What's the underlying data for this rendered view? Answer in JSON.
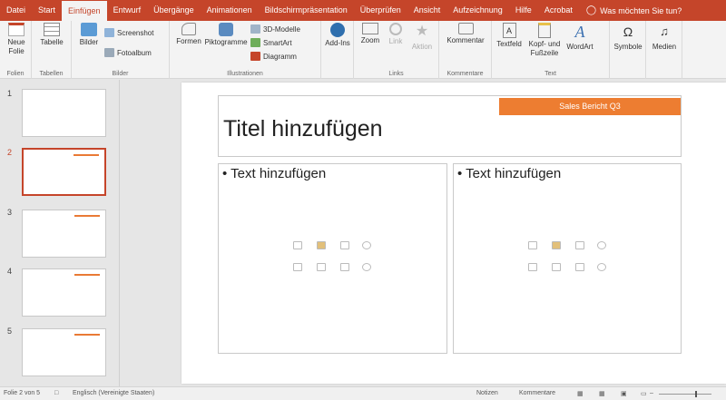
{
  "tabs": [
    "Datei",
    "Start",
    "Einfügen",
    "Entwurf",
    "Übergänge",
    "Animationen",
    "Bildschirmpräsentation",
    "Überprüfen",
    "Ansicht",
    "Aufzeichnung",
    "Hilfe",
    "Acrobat"
  ],
  "active_tab": "Einfügen",
  "tell_me": "Was möchten Sie tun?",
  "ribbon": {
    "neue_folie": "Neue Folie",
    "tabelle": "Tabelle",
    "bilder": "Bilder",
    "screenshot": "Screenshot",
    "fotoalbum": "Fotoalbum",
    "formen": "Formen",
    "piktogramme": "Piktogramme",
    "modelle_3d": "3D-Modelle",
    "smartart": "SmartArt",
    "diagramm": "Diagramm",
    "addins": "Add-Ins",
    "zoom": "Zoom",
    "link": "Link",
    "aktion": "Aktion",
    "kommentar": "Kommentar",
    "textfeld": "Textfeld",
    "kopf_fusszeile": "Kopf- und Fußzeile",
    "wordart": "WordArt",
    "symbole": "Symbole",
    "medien": "Medien",
    "groups": {
      "folien": "Folien",
      "tabellen": "Tabellen",
      "bilder": "Bilder",
      "illustrationen": "Illustrationen",
      "links": "Links",
      "kommentare": "Kommentare",
      "text": "Text"
    }
  },
  "thumbnails": [
    "1",
    "2",
    "3",
    "4",
    "5"
  ],
  "selected_slide": "2",
  "slide": {
    "title_placeholder": "Titel hinzufügen",
    "badge": "Sales Bericht Q3",
    "left_placeholder": "• Text hinzufügen",
    "right_placeholder": "• Text hinzufügen"
  },
  "status": {
    "slide_info": "Folie 2 von 5",
    "language": "Englisch (Vereinigte Staaten)",
    "notes": "Notizen",
    "comments": "Kommentare"
  },
  "colors": {
    "accent": "#c5452a",
    "badge": "#ed7d31"
  }
}
